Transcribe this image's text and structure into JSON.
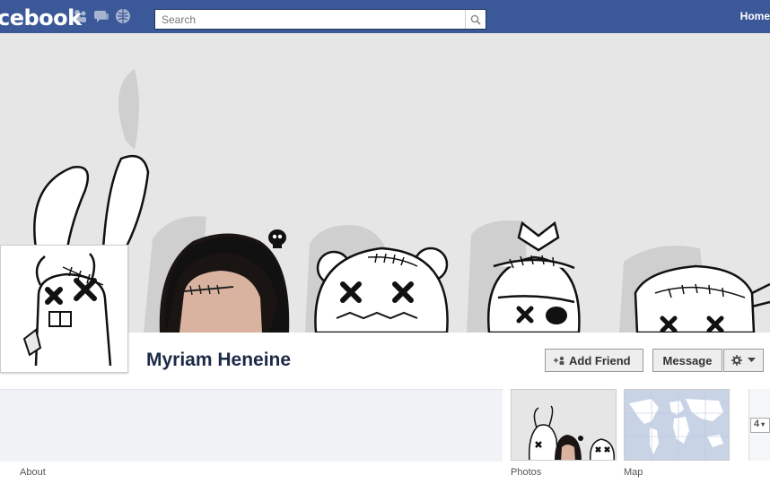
{
  "header": {
    "logo": "cebook",
    "search_placeholder": "Search",
    "home_label": "Home"
  },
  "profile": {
    "name": "Myriam Heneine"
  },
  "actions": {
    "add_friend": "Add Friend",
    "message": "Message"
  },
  "sections": {
    "about_label": "About",
    "photos_label": "Photos",
    "map_label": "Map",
    "count": "4"
  },
  "colors": {
    "header_bg": "#3b5998",
    "name_color": "#1c2a47"
  },
  "icons": [
    "friends-icon",
    "messages-icon",
    "notifications-icon",
    "search-icon",
    "gear-icon",
    "chevron-down-icon",
    "add-friend-icon"
  ]
}
